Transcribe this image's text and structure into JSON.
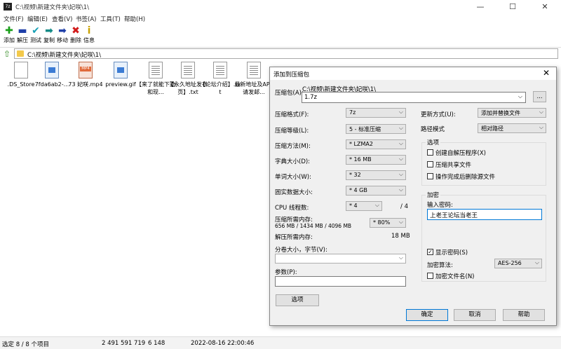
{
  "window": {
    "app_icon": "7z",
    "title": "C:\\视频\\新建文件夹\\妃咲\\1\\",
    "controls": [
      "—",
      "☐",
      "✕"
    ]
  },
  "menu": [
    "文件(F)",
    "编辑(E)",
    "查看(V)",
    "书签(A)",
    "工具(T)",
    "帮助(H)"
  ],
  "toolbar": [
    {
      "icon": "add-icon",
      "glyph": "✚",
      "color": "#1a9f1a",
      "label": "添加"
    },
    {
      "icon": "extract-icon",
      "glyph": "▬",
      "color": "#1f3fa8",
      "label": "解压"
    },
    {
      "icon": "test-icon",
      "glyph": "✔",
      "color": "#16a0b5",
      "label": "测试"
    },
    {
      "icon": "copy-icon",
      "glyph": "➡",
      "color": "#138a86",
      "label": "复制"
    },
    {
      "icon": "move-icon",
      "glyph": "➡",
      "color": "#1f3fa8",
      "label": "移动"
    },
    {
      "icon": "delete-icon",
      "glyph": "✖",
      "color": "#d11a1a",
      "label": "删除"
    },
    {
      "icon": "info-icon",
      "glyph": "i",
      "color": "#c9a200",
      "label": "信息"
    }
  ],
  "address": {
    "path": "C:\\视频\\新建文件夹\\妃咲\\1\\"
  },
  "files": [
    {
      "name": ".DS_Store",
      "type": "file"
    },
    {
      "name": "7fda6ab2-...",
      "type": "image"
    },
    {
      "name": "73 妃咲.mp4",
      "type": "mp4",
      "badge": "MP4"
    },
    {
      "name": "preview.gif",
      "type": "image"
    },
    {
      "name": "【来了就能下勤和现...",
      "type": "text"
    },
    {
      "name": "【永久地址发布页】.txt",
      "type": "text"
    },
    {
      "name": "【论坛介绍】.txt",
      "type": "text"
    },
    {
      "name": "最新地址及APP请发邮...",
      "type": "text"
    }
  ],
  "status": {
    "selected": "选定 8 / 8 个项目",
    "size": "2 491 591 719",
    "packed": "6 148",
    "modified": "2022-08-16 22:00:46"
  },
  "dialog": {
    "title": "添加到压缩包",
    "archive_label": "压缩包(A):",
    "archive_path": "C:\\视频\\新建文件夹\\妃咲\\1\\",
    "archive_name": "1.7z",
    "browse": "...",
    "format_label": "压缩格式(F):",
    "format": "7z",
    "level_label": "压缩等级(L):",
    "level": "5 - 标准压缩",
    "method_label": "压缩方法(M):",
    "method": "* LZMA2",
    "dict_label": "字典大小(D):",
    "dict": "* 16 MB",
    "word_label": "单词大小(W):",
    "word": "* 32",
    "solid_label": "固实数据大小:",
    "solid": "* 4 GB",
    "cpu_label": "CPU 线程数:",
    "cpu": "* 4",
    "cpu_max": "/ 4",
    "mem_comp_label": "压缩所需内存:",
    "mem_comp_detail": "656 MB / 1434 MB / 4096 MB",
    "mem_pct": "* 80%",
    "mem_decomp_label": "解压所需内存:",
    "mem_decomp": "18 MB",
    "split_label": "分卷大小，字节(V):",
    "params_label": "参数(P):",
    "options_button": "选项",
    "update_label": "更新方式(U):",
    "update": "添加并替换文件",
    "pathmode_label": "路径模式",
    "pathmode": "相对路径",
    "options_group": "选项",
    "opt_sfx": "创建自解压程序(X)",
    "opt_shared": "压缩共享文件",
    "opt_delete": "操作完成后删除源文件",
    "encrypt_group": "加密",
    "password_label": "输入密码:",
    "password": "上老王论坛当老王",
    "show_password": "显示密码(S)",
    "enc_method_label": "加密算法:",
    "enc_method": "AES-256",
    "enc_names": "加密文件名(N)",
    "ok": "确定",
    "cancel": "取消",
    "help": "帮助"
  }
}
